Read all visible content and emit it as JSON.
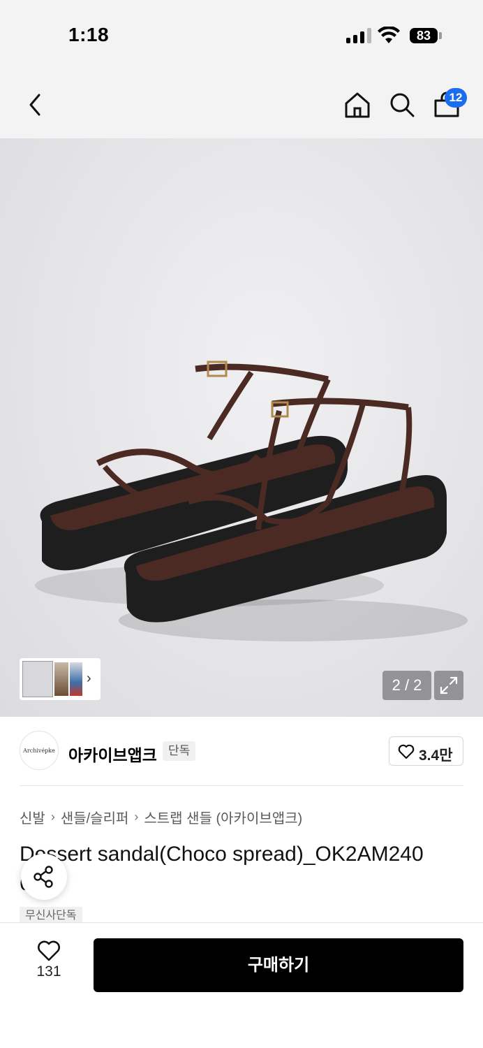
{
  "status": {
    "time": "1:18",
    "battery": "83"
  },
  "nav": {
    "cart_count": "12"
  },
  "gallery": {
    "pager": "2 / 2"
  },
  "brand": {
    "logo_text": "Archivépke",
    "name": "아카이브앱크",
    "tag": "단독",
    "like_count": "3.4만"
  },
  "breadcrumb": {
    "items": [
      "신발",
      "샌들/슬리퍼",
      "스트랩 샌들 (아카이브앱크)"
    ]
  },
  "product": {
    "title": "Dessert sandal(Choco spread)_OK2AM240 6XB",
    "badge": "무신사단독"
  },
  "bottom": {
    "wish_count": "131",
    "buy_label": "구매하기"
  },
  "colors": {
    "badge_blue": "#1a6cf0",
    "buy_button": "#000000",
    "strap_brown": "#4b2a23",
    "sole_black": "#1e1e1f"
  }
}
